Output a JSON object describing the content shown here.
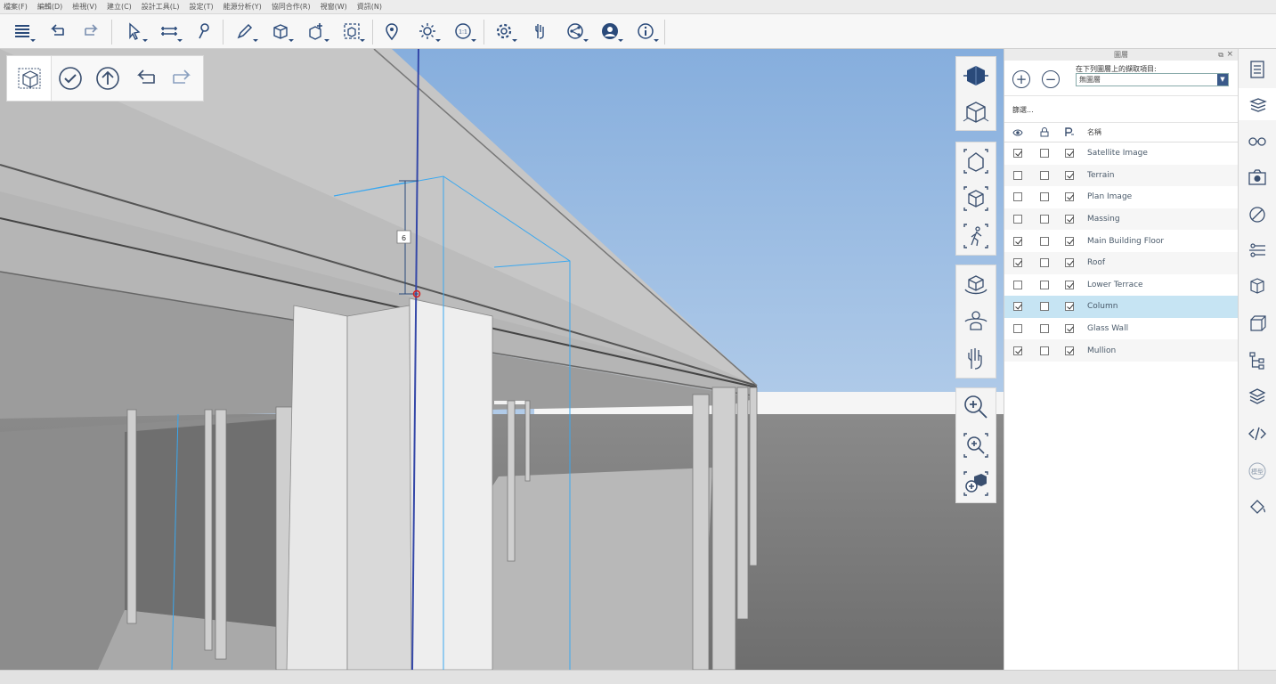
{
  "menu": [
    "檔案(F)",
    "編輯(D)",
    "檢視(V)",
    "建立(C)",
    "設計工具(L)",
    "設定(T)",
    "能源分析(Y)",
    "協同合作(R)",
    "視窗(W)",
    "資訊(N)"
  ],
  "toolbar_icons": [
    "layers-menu-icon",
    "undo-icon",
    "redo-icon",
    "select-arrow-icon",
    "measure-icon",
    "probe-icon",
    "pencil-draw-icon",
    "add-box-icon",
    "add-object-icon",
    "frame-box-icon",
    "location-pin-icon",
    "sun-icon",
    "scale-icon",
    "settings-gear-icon",
    "touch-hand-icon",
    "share-icon",
    "user-account-icon",
    "info-icon"
  ],
  "viewport": {
    "dimension_label": "6",
    "mini_toolbar": [
      "box-select-icon",
      "check-icon",
      "up-arrow-icon",
      "undo-icon",
      "redo-icon"
    ]
  },
  "view_tools": [
    "view-cube-icon",
    "perspective-icon",
    "home-view-icon",
    "fit-view-icon",
    "walk-icon",
    "orbit-icon",
    "look-around-icon",
    "pan-hand-icon",
    "zoom-in-icon",
    "zoom-window-icon",
    "zoom-extents-icon"
  ],
  "layers_panel": {
    "title": "圖層",
    "select_label": "在下列圖層上的擷取項目:",
    "select_value": "無圖層",
    "filter_text": "篩選...",
    "name_header": "名稱",
    "layers": [
      {
        "name": "Satellite Image",
        "visible": true,
        "locked": false,
        "render": true
      },
      {
        "name": "Terrain",
        "visible": false,
        "locked": false,
        "render": true
      },
      {
        "name": "Plan Image",
        "visible": false,
        "locked": false,
        "render": true
      },
      {
        "name": "Massing",
        "visible": false,
        "locked": false,
        "render": true
      },
      {
        "name": "Main Building Floor",
        "visible": true,
        "locked": false,
        "render": true
      },
      {
        "name": "Roof",
        "visible": true,
        "locked": false,
        "render": true
      },
      {
        "name": "Lower Terrace",
        "visible": false,
        "locked": false,
        "render": true
      },
      {
        "name": "Column",
        "visible": true,
        "locked": false,
        "render": true,
        "selected": true
      },
      {
        "name": "Glass Wall",
        "visible": false,
        "locked": false,
        "render": true
      },
      {
        "name": "Mullion",
        "visible": true,
        "locked": false,
        "render": true
      }
    ]
  },
  "right_sidebar": {
    "icons": [
      "properties-panel-icon",
      "layers-panel-icon",
      "glasses-icon",
      "camera-icon",
      "no-visibility-icon",
      "section-plane-icon",
      "box-section-icon",
      "cube-view-icon",
      "tree-structure-icon",
      "stack-layers-icon",
      "code-icon",
      "model-icon",
      "paint-bucket-icon"
    ],
    "model_label": "模型"
  },
  "colors": {
    "accent": "#2a4a7a",
    "selected_row": "#c6e4f3",
    "sky": "#9fbfe3"
  }
}
